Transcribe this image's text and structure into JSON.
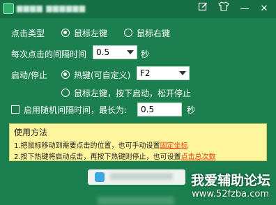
{
  "titlebar": {
    "edit_icon": "pencil-square-icon",
    "skin_icon": "tshirt-icon",
    "minimize_label": "—",
    "close_label": "✕"
  },
  "click_type": {
    "label": "点击类型",
    "option_left": "鼠标左键",
    "option_right": "鼠标右键",
    "selected": "left"
  },
  "interval": {
    "label": "每次点击的间隔时间",
    "value": "0.5",
    "unit": "秒"
  },
  "start_stop": {
    "label": "启动/停止",
    "option_hotkey": "热键(可自定义)",
    "hotkey_value": "F2",
    "option_mouse": "鼠标左键，按下启动，松开停止",
    "selected": "hotkey"
  },
  "random": {
    "checkbox_label": "启用随机间隔时间，最长为:",
    "checked": false,
    "value": "0.5",
    "unit": "秒"
  },
  "help": {
    "title": "使用方法",
    "line1_text": "1.把鼠标移动到需要点击的位置，也可手动设置",
    "line1_link": "固定坐标",
    "line2_text": "2.按下热键将启动点击，再按下热键则停止，也可设置",
    "line2_link": "点击总次数"
  },
  "watermark": {
    "title": "我爱辅助论坛",
    "url": "www.52fzba.com"
  },
  "colors": {
    "background": "#1b7f4f",
    "titlebar": "#176f45",
    "help_bg": "#fff59d",
    "link": "#e0401a"
  }
}
